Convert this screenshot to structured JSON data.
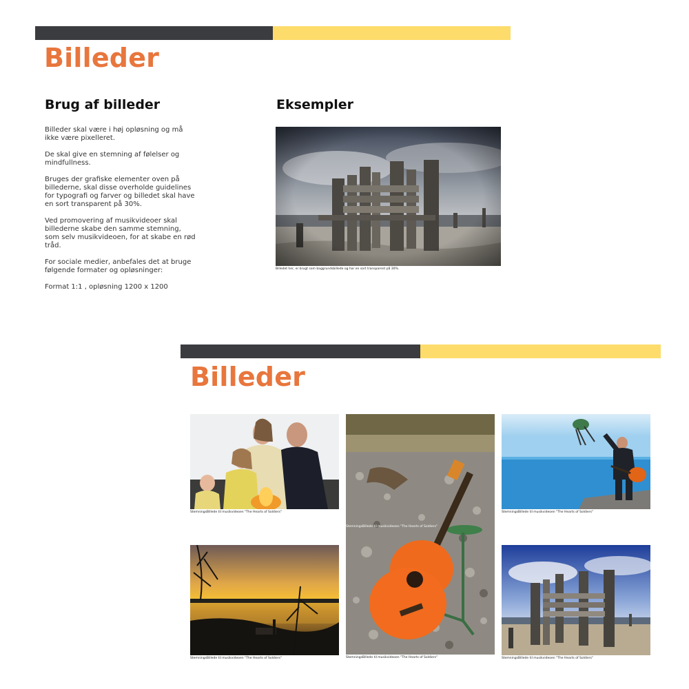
{
  "slide1": {
    "title": "Billeder",
    "section_left_title": "Brug af billeder",
    "section_right_title": "Eksempler",
    "paragraphs": [
      "Billeder skal være i høj opløsning og må ikke være pixelleret.",
      "De skal give en stemning af følelser og mindfullness.",
      "Bruges der grafiske elementer oven på billederne, skal disse overholde guidelines for typografi og farver og billedet skal have en sort transparent på 30%.",
      "Ved promovering af musikvideoer skal billederne skabe den samme stemning, som selv musikvideoen, for at skabe en rød tråd.",
      "For sociale medier, anbefales det at bruge følgende formater og opløsninger:",
      "Format 1:1 , opløsning 1200 x 1200"
    ],
    "example_caption": "Billedet her, er brugt som baggrundsbillede og har en sort transparent på 30%."
  },
  "slide2": {
    "title": "Billeder",
    "captions": {
      "family": "StemningsBillede til musikvideoen \"The Hearts of Soldiers\"",
      "guitar": "StemningsBillede til musikvideoen \"The Hearts of Soldiers\"",
      "man": "StemningsBillede til musikvideoen \"The Hearts of Soldiers\"",
      "sunset": "StemningsBillede til musikvideoen \"The Hearts of Soldiers\"",
      "bench_bottom": "StemningsBillede til musikvideoen \"The Hearts of Soldiers\"",
      "bench_right": "StemningsBillede til musikvideoen \"The Hearts of Soldiers\""
    }
  },
  "colors": {
    "accent": "#e8763d",
    "dark_bar": "#3b3c40",
    "yellow_bar": "#fddc6b"
  }
}
